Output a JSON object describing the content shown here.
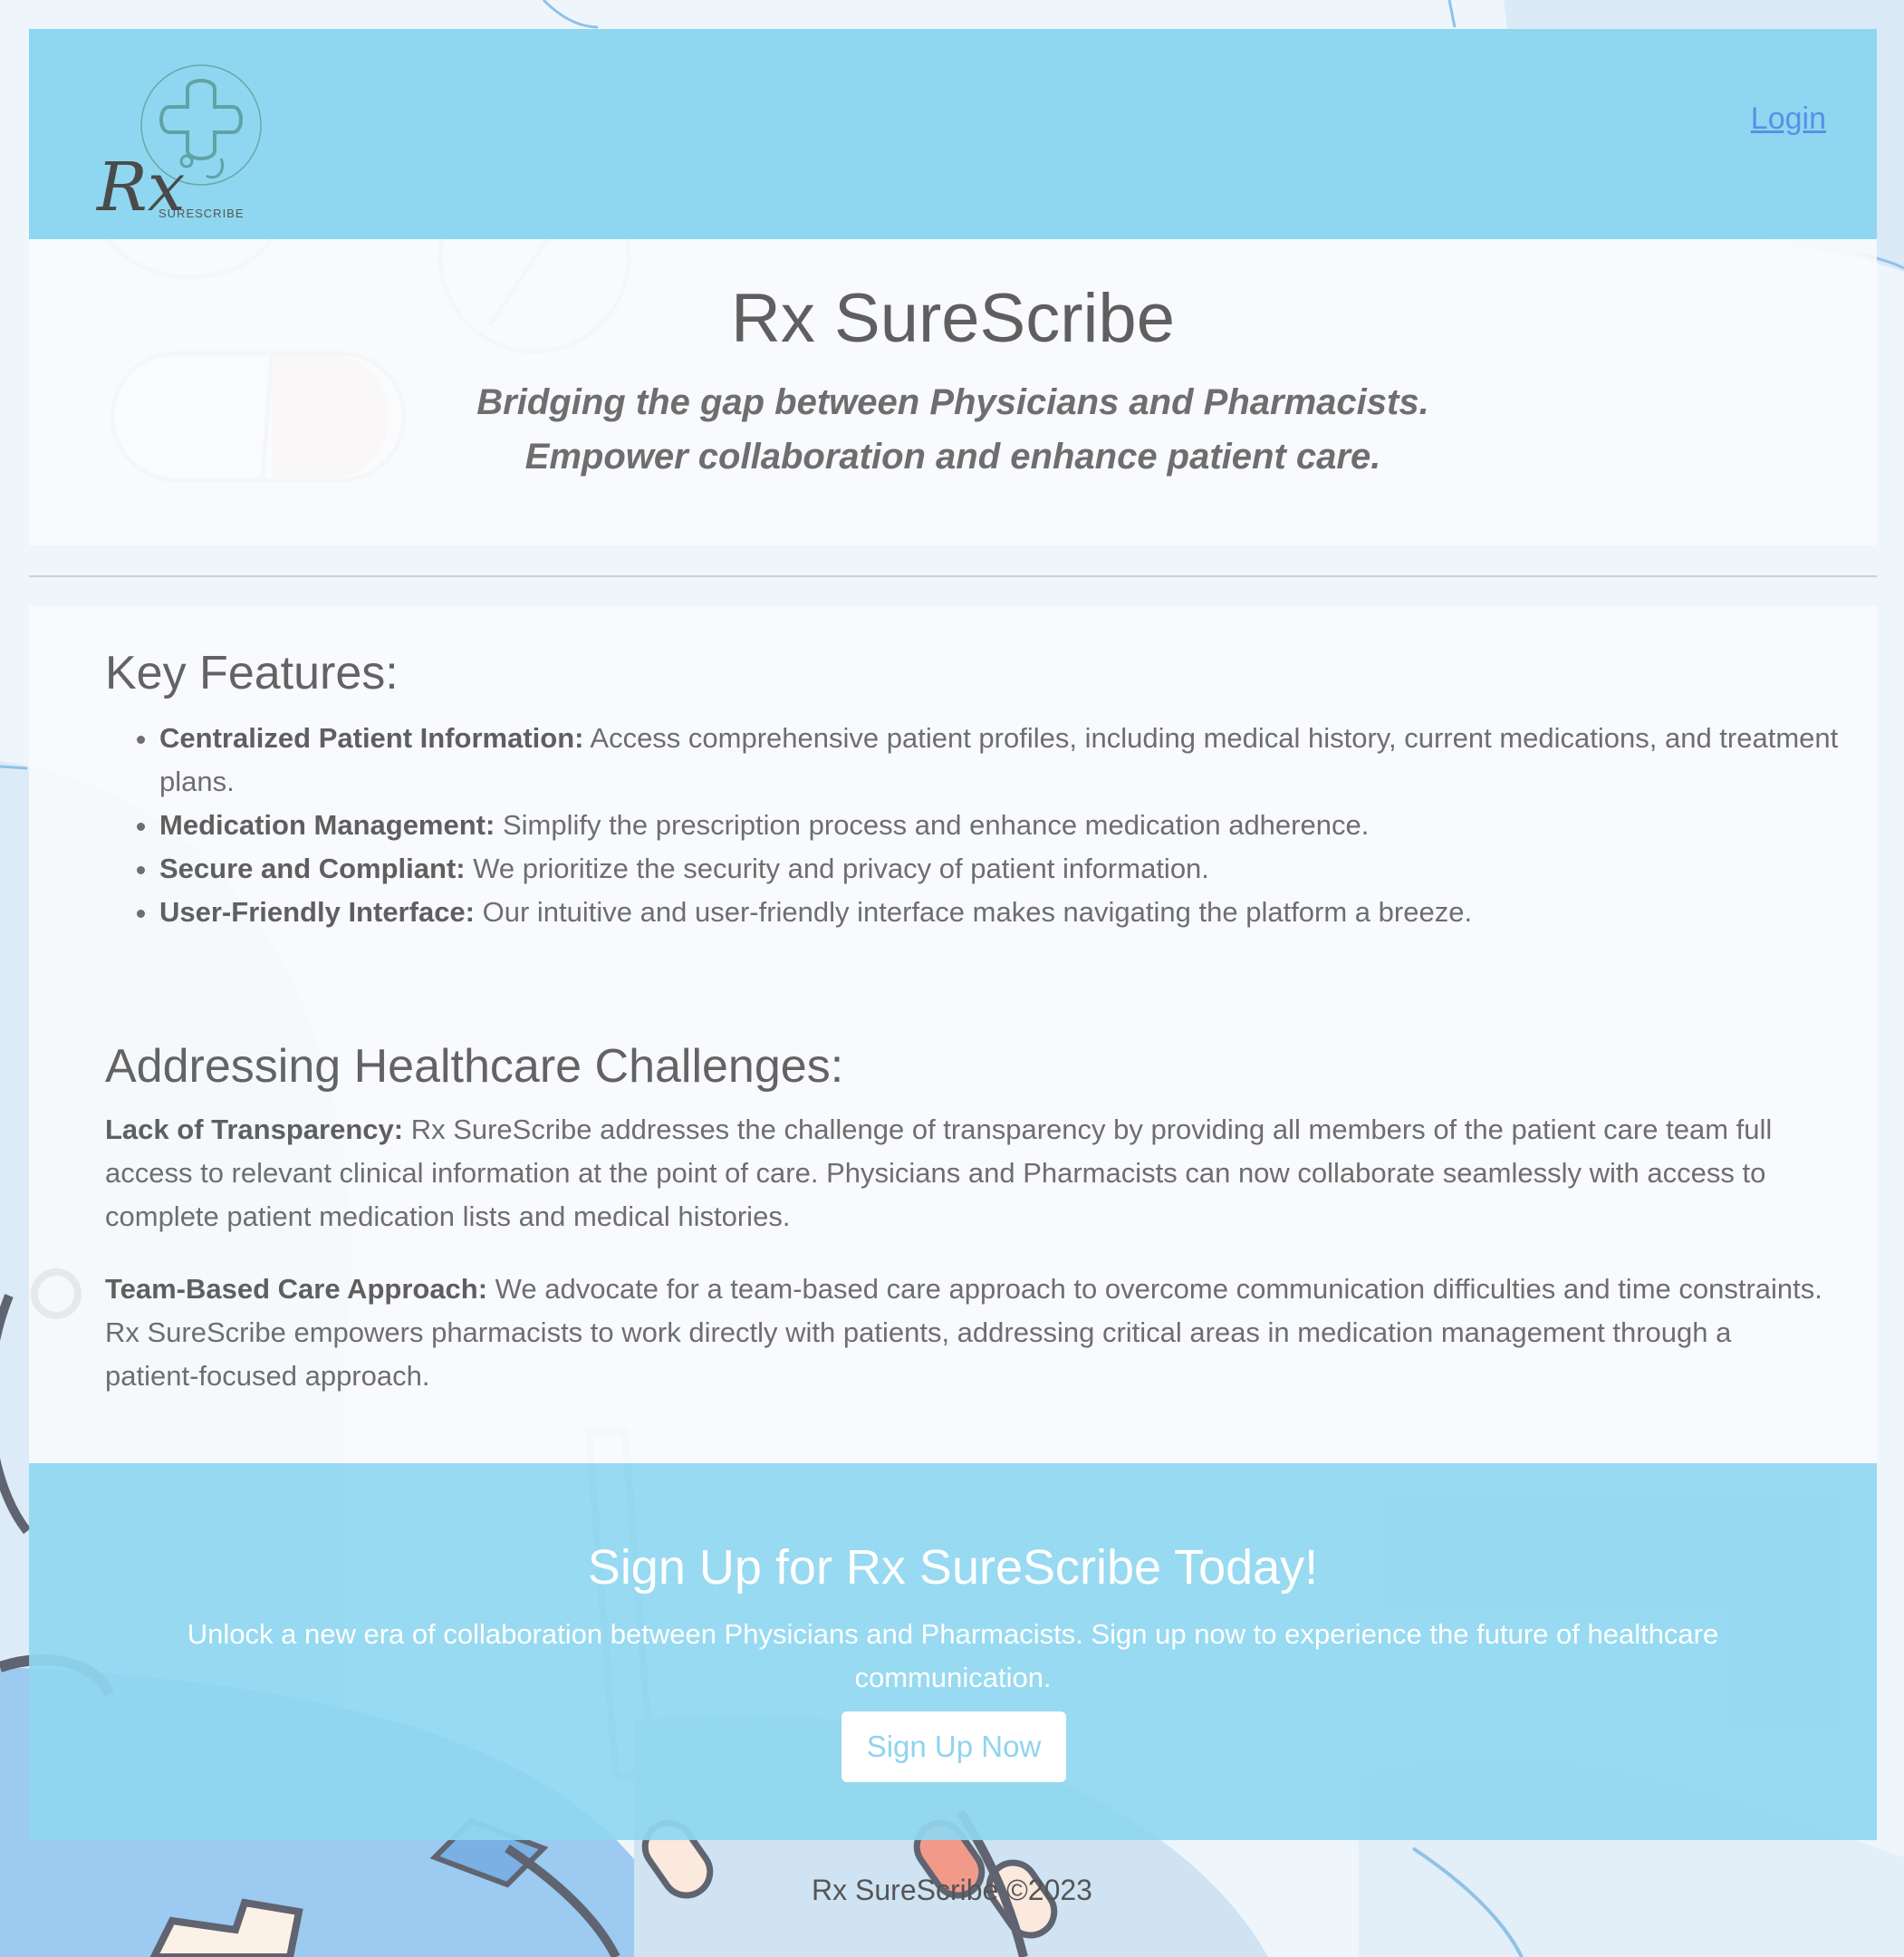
{
  "header": {
    "logo_text": "Rx",
    "logo_subtext": "SURESCRIBE",
    "login_label": "Login"
  },
  "hero": {
    "title": "Rx SureScribe",
    "tagline_line1": "Bridging the gap between Physicians and Pharmacists.",
    "tagline_line2": "Empower collaboration and enhance patient care."
  },
  "features": {
    "heading": "Key Features:",
    "items": [
      {
        "title": "Centralized Patient Information:",
        "text": " Access comprehensive patient profiles, including medical history, current medications, and treatment plans."
      },
      {
        "title": "Medication Management:",
        "text": " Simplify the prescription process and enhance medication adherence."
      },
      {
        "title": "Secure and Compliant:",
        "text": " We prioritize the security and privacy of patient information."
      },
      {
        "title": "User-Friendly Interface:",
        "text": " Our intuitive and user-friendly interface makes navigating the platform a breeze."
      }
    ]
  },
  "challenges": {
    "heading": "Addressing Healthcare Challenges:",
    "paragraphs": [
      {
        "title": "Lack of Transparency:",
        "text": " Rx SureScribe addresses the challenge of transparency by providing all members of the patient care team full access to relevant clinical information at the point of care. Physicians and Pharmacists can now collaborate seamlessly with access to complete patient medication lists and medical histories."
      },
      {
        "title": "Team-Based Care Approach:",
        "text": " We advocate for a team-based care approach to overcome communication difficulties and time constraints. Rx SureScribe empowers pharmacists to work directly with patients, addressing critical areas in medication management through a patient-focused approach."
      }
    ]
  },
  "cta": {
    "heading": "Sign Up for Rx SureScribe Today!",
    "text": "Unlock a new era of collaboration between Physicians and Pharmacists. Sign up now to experience the future of healthcare communication.",
    "button_label": "Sign Up Now"
  },
  "footer": {
    "text": "Rx SureScribe ©2023"
  },
  "colors": {
    "accent": "#8fd7f0",
    "link": "#5a8fe6",
    "background": "#eef6fc"
  }
}
